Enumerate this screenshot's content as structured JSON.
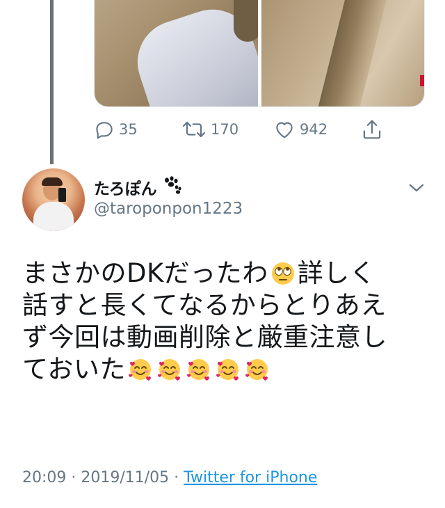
{
  "previous_tweet": {
    "actions": {
      "reply_count": "35",
      "retweet_count": "170",
      "like_count": "942"
    }
  },
  "tweet": {
    "display_name": "たろぽん",
    "handle": "@taroponpon1223",
    "text_lines": [
      "まさかのDKだったわ",
      "詳しく",
      "話すと長くてなるからとりあえ",
      "ず今回は動画削除と厳重注意し",
      "ておいた"
    ],
    "timestamp": "20:09 · 2019/11/05 · ",
    "source": "Twitter for iPhone"
  },
  "icons": {
    "reply": "reply-icon",
    "retweet": "retweet-icon",
    "like": "heart-icon",
    "share": "share-icon",
    "more": "chevron-down-icon",
    "name_badge": "paw-icon",
    "emoji_eye_roll": "face-with-rolling-eyes-emoji",
    "emoji_hearts": "smiling-face-with-hearts-emoji"
  },
  "colors": {
    "text": "#14171a",
    "secondary": "#657786",
    "link": "#1b95e0",
    "thread_line": "#6b7178"
  }
}
